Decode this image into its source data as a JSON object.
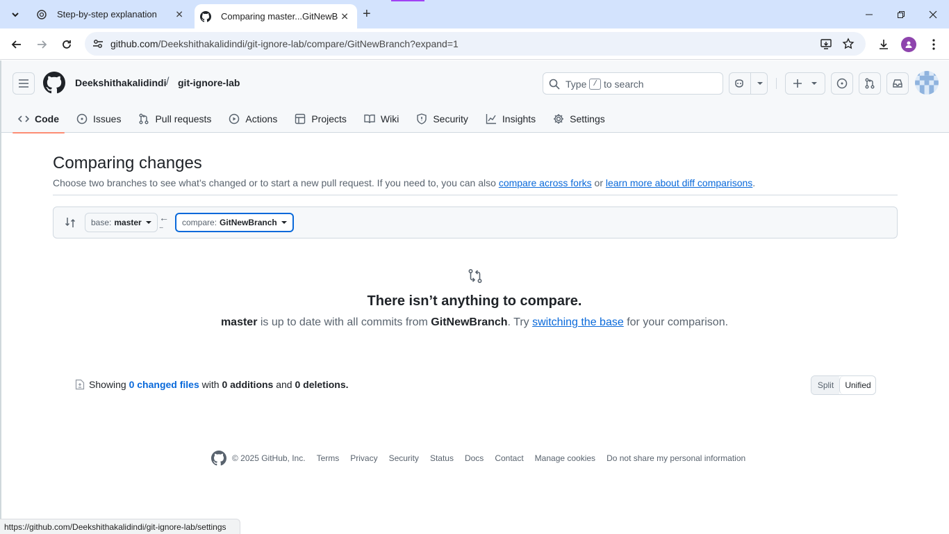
{
  "browser": {
    "tabs": [
      {
        "title": "Step-by-step explanation",
        "icon": "chatgpt-icon",
        "active": false
      },
      {
        "title": "Comparing master...GitNewBranch",
        "icon": "github-icon",
        "active": true
      }
    ],
    "url_host": "github.com",
    "url_path": "/Deekshithakalidindi/git-ignore-lab/compare/GitNewBranch?expand=1",
    "status_url": "https://github.com/Deekshithakalidindi/git-ignore-lab/settings"
  },
  "header": {
    "owner": "Deekshithakalidindi",
    "separator": "/",
    "repo": "git-ignore-lab",
    "search_prefix": "Type",
    "search_key": "/",
    "search_suffix": "to search"
  },
  "repo_nav": [
    {
      "label": "Code",
      "icon": "code-icon",
      "selected": true
    },
    {
      "label": "Issues",
      "icon": "issue-icon",
      "selected": false
    },
    {
      "label": "Pull requests",
      "icon": "pull-request-icon",
      "selected": false
    },
    {
      "label": "Actions",
      "icon": "play-icon",
      "selected": false
    },
    {
      "label": "Projects",
      "icon": "table-icon",
      "selected": false
    },
    {
      "label": "Wiki",
      "icon": "book-icon",
      "selected": false
    },
    {
      "label": "Security",
      "icon": "shield-icon",
      "selected": false
    },
    {
      "label": "Insights",
      "icon": "graph-icon",
      "selected": false
    },
    {
      "label": "Settings",
      "icon": "gear-icon",
      "selected": false
    }
  ],
  "compare": {
    "title": "Comparing changes",
    "subtitle_text": "Choose two branches to see what’s changed or to start a new pull request. If you need to, you can also",
    "link_forks": "compare across forks",
    "subtitle_or": "or",
    "link_learn": "learn more about diff comparisons",
    "subtitle_end": ".",
    "base_label": "base:",
    "base_value": "master",
    "compare_label": "compare:",
    "compare_value": "GitNewBranch",
    "arrow": "←",
    "dots": "..."
  },
  "blankslate": {
    "title": "There isn’t anything to compare.",
    "base": "master",
    "middle": "is up to date with all commits from",
    "head": "GitNewBranch",
    "try": ". Try",
    "link": "switching the base",
    "end": "for your comparison."
  },
  "summary": {
    "showing": "Showing",
    "files": "0 changed files",
    "with": "with",
    "additions": "0 additions",
    "and": "and",
    "deletions": "0 deletions",
    "period": "."
  },
  "diff_view": {
    "split": "Split",
    "unified": "Unified",
    "selected": "Unified"
  },
  "footer": {
    "copyright": "© 2025 GitHub, Inc.",
    "links": [
      "Terms",
      "Privacy",
      "Security",
      "Status",
      "Docs",
      "Contact",
      "Manage cookies",
      "Do not share my personal information"
    ]
  },
  "colors": {
    "link": "#0969da",
    "nav_underline": "#fd8c73",
    "tabbar": "#d3e3fd"
  }
}
